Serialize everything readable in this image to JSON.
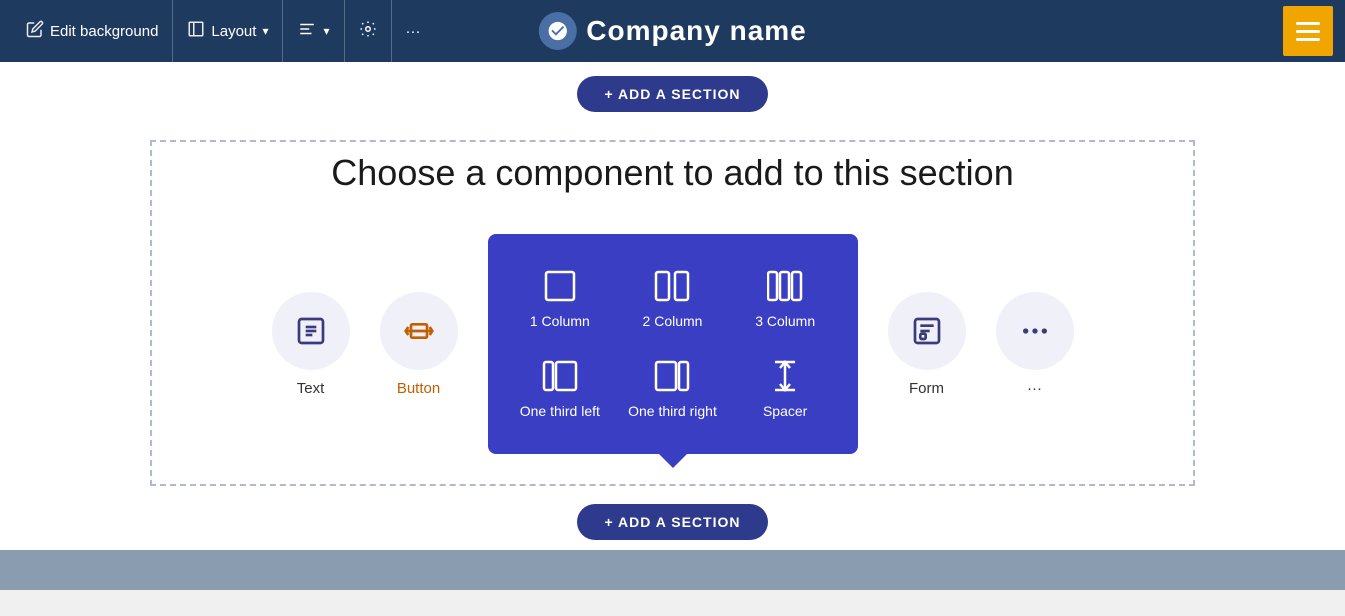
{
  "header": {
    "company_name": "Company name",
    "edit_background_label": "Edit background",
    "layout_label": "Layout",
    "align_label": "",
    "settings_label": "",
    "more_label": "···"
  },
  "add_section": {
    "top_label": "+ ADD A SECTION",
    "bottom_label": "+ ADD A SECTION"
  },
  "section": {
    "title": "Choose a component to add to this section"
  },
  "components": [
    {
      "id": "text",
      "label": "Text",
      "icon": "T",
      "orange": false
    },
    {
      "id": "button",
      "label": "Button",
      "icon": "cursor",
      "orange": true
    }
  ],
  "layout_panel": {
    "items": [
      {
        "id": "one-column",
        "label": "1 Column"
      },
      {
        "id": "two-column",
        "label": "2 Column"
      },
      {
        "id": "three-column",
        "label": "3 Column"
      },
      {
        "id": "one-third-left",
        "label": "One third left"
      },
      {
        "id": "one-third-right",
        "label": "One third right"
      },
      {
        "id": "spacer",
        "label": "Spacer"
      }
    ]
  },
  "extra_components": [
    {
      "id": "form",
      "label": "Form",
      "icon": "form"
    },
    {
      "id": "more",
      "label": "···",
      "icon": "more"
    }
  ]
}
